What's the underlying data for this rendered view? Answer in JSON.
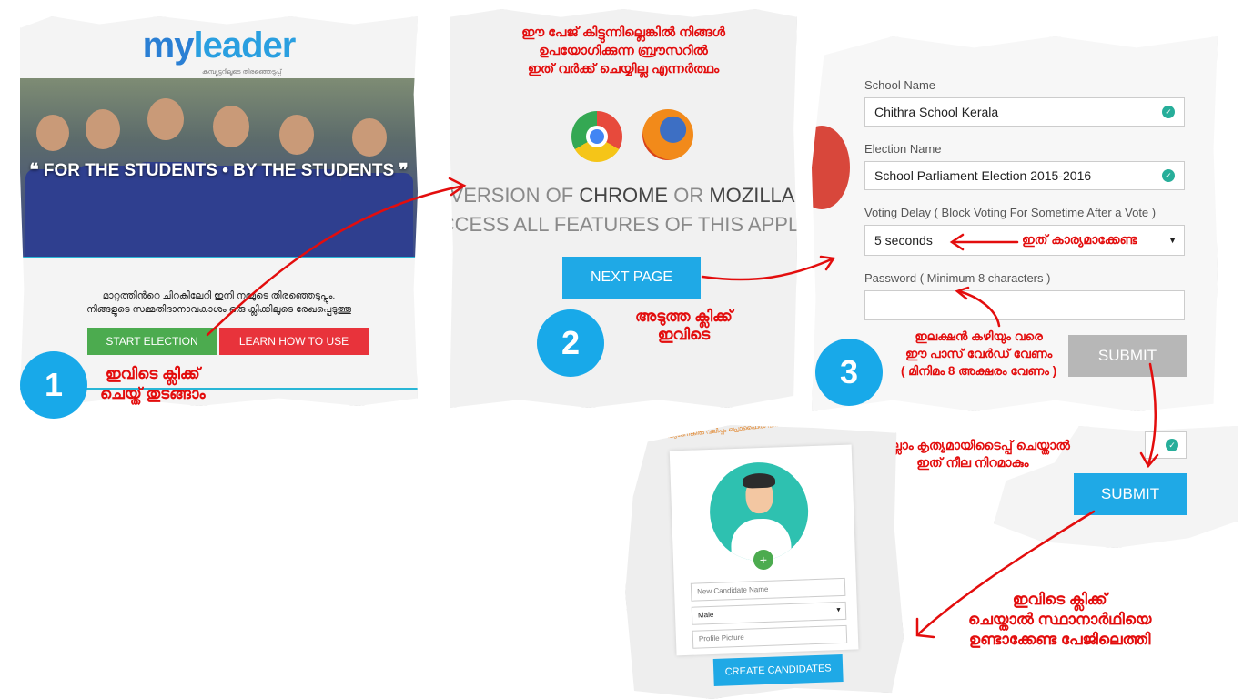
{
  "panel1": {
    "brand_my": "my",
    "brand_leader": "leader",
    "brand_sub": "കമ്പ്യൂട്ടറിലൂടെ തിരഞ്ഞെടുപ്പ്",
    "hero_title": "❝ FOR THE STUDENTS • BY THE STUDENTS ❞",
    "text_line1": "മാറ്റത്തിൻറെ ചിറകിലേറി ഇനി നമ്മുടെ തിരഞ്ഞെടുപ്പും.",
    "text_line2": "നിങ്ങളുടെ സമ്മതിദാനാവകാശം ഒരു ക്ലിക്കിലൂടെ രേഖപ്പെടുത്തൂ",
    "start_button": "START ELECTION",
    "learn_button": "LEARN HOW TO USE",
    "note_line1": "ഇവിടെ ക്ലിക്ക്",
    "note_line2": "ചെയ്ത് തുടങ്ങാം",
    "step": "1"
  },
  "panel2": {
    "note_line1": "ഈ പേജ് കിട്ടുന്നില്ലെങ്കിൽ നിങ്ങൾ",
    "note_line2": "ഉപയോഗിക്കുന്ന ബ്രൗസറിൽ",
    "note_line3": "ഇത് വർക്ക് ചെയ്യില്ല എന്നർത്ഥം",
    "big_line1_a": "VERSION OF ",
    "big_line1_b": "CHROME",
    "big_line1_c": " OR ",
    "big_line1_d": "MOZILLA",
    "big_line2": "CCESS ALL FEATURES OF THIS APPLI",
    "next_button": "NEXT PAGE",
    "click_line1": "അടുത്ത ക്ലിക്ക്",
    "click_line2": "ഇവിടെ",
    "step": "2"
  },
  "panel3": {
    "school_label": "School Name",
    "school_value": "Chithra School Kerala",
    "election_label": "Election Name",
    "election_value": "School Parliament Election 2015-2016",
    "delay_label": "Voting Delay ( Block Voting For Sometime After a Vote )",
    "delay_value": "5 seconds",
    "delay_note": "ഇത് കാര്യമാക്കേണ്ട",
    "password_label": "Password ( Minimum 8 characters )",
    "password_value": "",
    "submit_button": "SUBMIT",
    "pass_note_line1": "ഇലക്ഷൻ കഴിയും വരെ",
    "pass_note_line2": "ഈ പാസ് വേർഡ് വേണം",
    "pass_note_line3": "( മിനിമം 8 അക്ഷരം വേണം )",
    "step": "3"
  },
  "panel4": {
    "note_line1": "എല്ലാം കൃത്യമായിടൈപ്പ് ചെയ്താൽ",
    "note_line2": "ഇത് നീല നിറമാകും",
    "submit_button": "SUBMIT"
  },
  "panel5": {
    "top_text1": "ആണെങ്കിൽ വലിപ്പം പ്രൊഫൈൽ പിക്ചർ",
    "top_text2": "പേര് എന്ന ബോക്സിൽ",
    "name_placeholder": "New Candidate Name",
    "gender_value": "Male",
    "picture_placeholder": "Profile Picture",
    "create_button": "CREATE CANDIDATES",
    "note_line1": "ഇവിടെ ക്ലിക്ക്",
    "note_line2": "ചെയ്താൽ സ്ഥാനാർഥിയെ",
    "note_line3": "ഉണ്ടാക്കേണ്ട പേജിലെത്തി"
  },
  "colors": {
    "annotation_red": "#e30d0d",
    "step_blue": "#18a9e9",
    "button_blue": "#1fa9e6",
    "button_green": "#4cab4f",
    "button_red": "#e8333b",
    "check_teal": "#27ae9a"
  }
}
